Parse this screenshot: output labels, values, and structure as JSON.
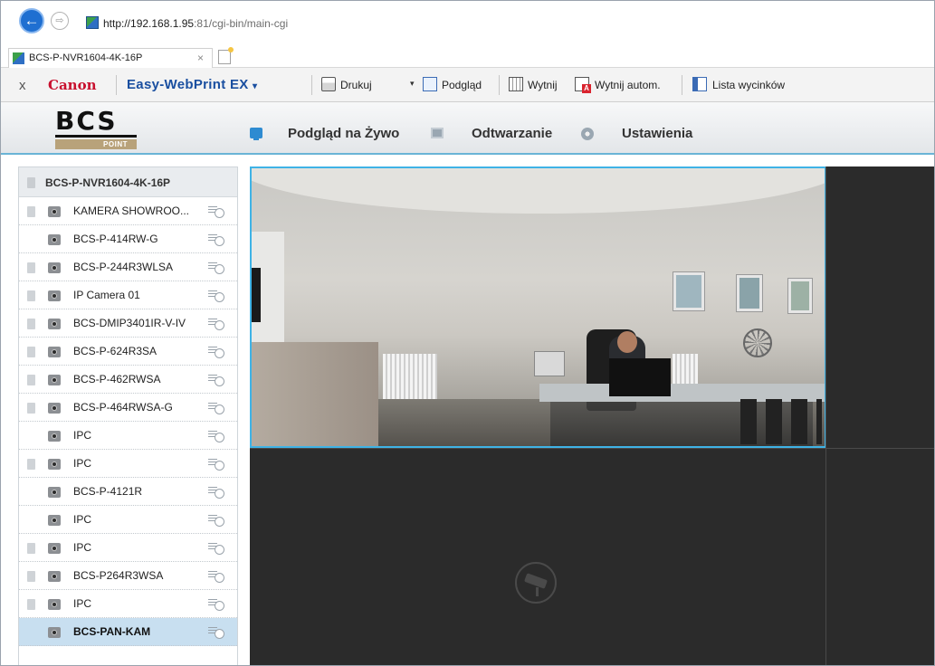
{
  "browser": {
    "url_host": "http://192.168.1.95",
    "url_rest": ":81/cgi-bin/main-cgi",
    "tab_title": "BCS-P-NVR1604-4K-16P",
    "tab_close": "×"
  },
  "canon_toolbar": {
    "close": "x",
    "brand": "Canon",
    "product": "Easy-WebPrint EX",
    "product_caret": "▾",
    "print": "Drukuj",
    "preview_caret": "▾",
    "preview": "Podgląd",
    "cut": "Wytnij",
    "cut_auto": "Wytnij autom.",
    "clip_list": "Lista wycinków"
  },
  "nvr": {
    "logo_text": "BCS",
    "logo_sub": "POINT",
    "menu": {
      "live": "Podgląd na Żywo",
      "playback": "Odtwarzanie",
      "settings": "Ustawienia"
    }
  },
  "sidebar": {
    "device": "BCS-P-NVR1604-4K-16P",
    "cameras": [
      {
        "label": "KAMERA SHOWROO...",
        "rec": true,
        "selected": false
      },
      {
        "label": "BCS-P-414RW-G",
        "rec": false,
        "selected": false
      },
      {
        "label": "BCS-P-244R3WLSA",
        "rec": true,
        "selected": false
      },
      {
        "label": "IP Camera 01",
        "rec": true,
        "selected": false
      },
      {
        "label": "BCS-DMIP3401IR-V-IV",
        "rec": true,
        "selected": false
      },
      {
        "label": "BCS-P-624R3SA",
        "rec": true,
        "selected": false
      },
      {
        "label": "BCS-P-462RWSA",
        "rec": true,
        "selected": false
      },
      {
        "label": "BCS-P-464RWSA-G",
        "rec": true,
        "selected": false
      },
      {
        "label": "IPC",
        "rec": false,
        "selected": false
      },
      {
        "label": "IPC",
        "rec": true,
        "selected": false
      },
      {
        "label": "BCS-P-4121R",
        "rec": false,
        "selected": false
      },
      {
        "label": "IPC",
        "rec": false,
        "selected": false
      },
      {
        "label": "IPC",
        "rec": true,
        "selected": false
      },
      {
        "label": "BCS-P264R3WSA",
        "rec": true,
        "selected": false
      },
      {
        "label": "IPC",
        "rec": true,
        "selected": false
      },
      {
        "label": "BCS-PAN-KAM",
        "rec": false,
        "selected": true
      }
    ]
  },
  "colors": {
    "accent": "#3fb3e6",
    "selected_row": "#c8dff0",
    "video_bg": "#2b2b2b",
    "canon_red": "#c8102e"
  }
}
